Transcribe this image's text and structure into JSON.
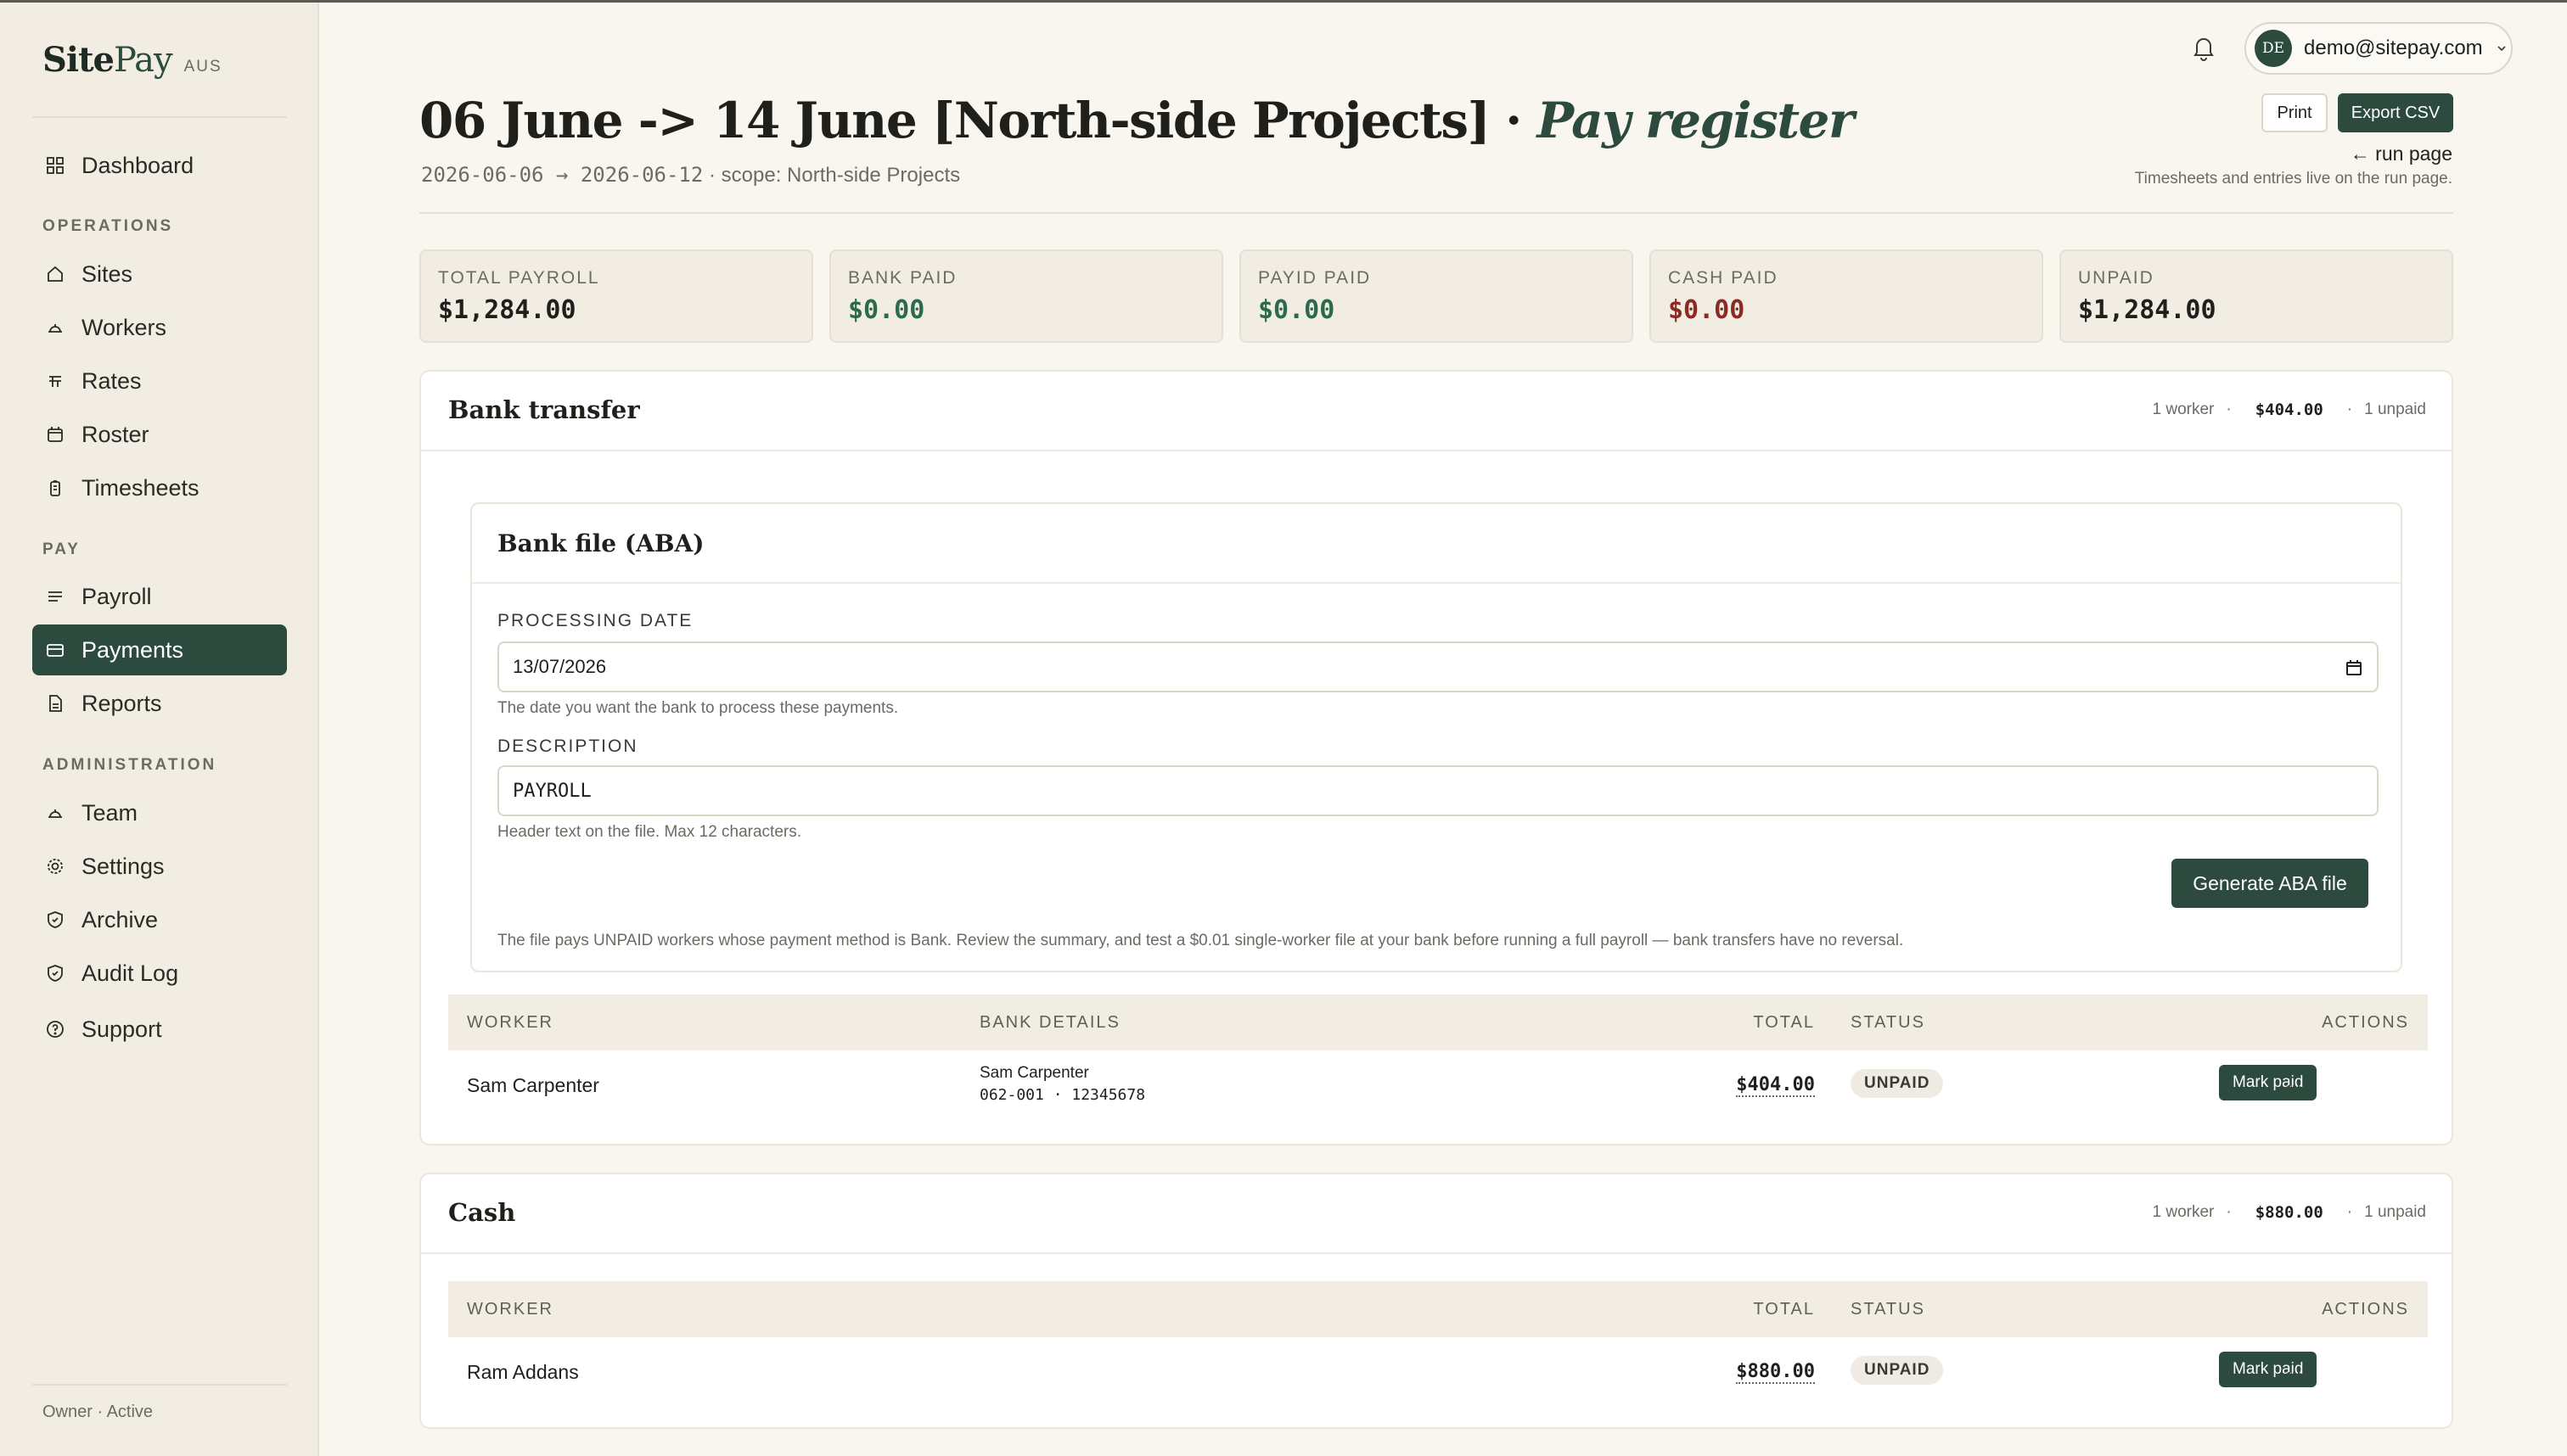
{
  "brand": {
    "name_a": "Site",
    "name_b": "Pay",
    "region": "AUS"
  },
  "sidebar": {
    "dashboard": "Dashboard",
    "sections": {
      "operations": "OPERATIONS",
      "pay": "PAY",
      "administration": "ADMINISTRATION"
    },
    "operations": [
      "Sites",
      "Workers",
      "Rates",
      "Roster",
      "Timesheets"
    ],
    "pay": [
      "Payroll",
      "Payments",
      "Reports"
    ],
    "administration": [
      "Team",
      "Settings",
      "Archive",
      "Audit Log",
      "Support"
    ],
    "active_item": "Payments",
    "footer": "Owner · Active"
  },
  "topbar": {
    "avatar_initials": "DE",
    "email": "demo@sitepay.com"
  },
  "header": {
    "title_main": "06 June -> 14 June [North-side Projects] · ",
    "title_accent": "Pay register",
    "sub_dates": "2026-06-06 → 2026-06-12",
    "sub_scope": " · scope: North-side Projects",
    "print_label": "Print",
    "export_label": "Export CSV",
    "run_link": "← run page",
    "run_note": "Timesheets and entries live on the run page."
  },
  "stats": [
    {
      "label": "TOTAL PAYROLL",
      "value": "$1,284.00",
      "color": "#1f1f1c"
    },
    {
      "label": "BANK PAID",
      "value": "$0.00",
      "color": "#2c6a4d"
    },
    {
      "label": "PAYID PAID",
      "value": "$0.00",
      "color": "#2c6a4d"
    },
    {
      "label": "CASH PAID",
      "value": "$0.00",
      "color": "#8b2a22"
    },
    {
      "label": "UNPAID",
      "value": "$1,284.00",
      "color": "#1f1f1c"
    }
  ],
  "bank": {
    "title": "Bank transfer",
    "meta_workers": "1 worker",
    "meta_amount": "$404.00",
    "meta_unpaid": "1 unpaid",
    "aba": {
      "title": "Bank file (ABA)",
      "date_label": "PROCESSING DATE",
      "date_value": "13/07/2026",
      "date_hint": "The date you want the bank to process these payments.",
      "desc_label": "DESCRIPTION",
      "desc_value": "PAYROLL",
      "desc_hint": "Header text on the file. Max 12 characters.",
      "generate_label": "Generate ABA file",
      "note": "The file pays UNPAID workers whose payment method is Bank. Review the summary, and test a $0.01 single-worker file at your bank before running a full payroll — bank transfers have no reversal."
    },
    "columns": {
      "worker": "WORKER",
      "bank_details": "BANK DETAILS",
      "total": "TOTAL",
      "status": "STATUS",
      "actions": "ACTIONS"
    },
    "rows": [
      {
        "worker": "Sam Carpenter",
        "bank_name": "Sam Carpenter",
        "bank_acct": "062-001 · 12345678",
        "total": "$404.00",
        "status": "UNPAID",
        "action": "Mark paid",
        "more": "..."
      }
    ]
  },
  "cash": {
    "title": "Cash",
    "meta_workers": "1 worker",
    "meta_amount": "$880.00",
    "meta_unpaid": "1 unpaid",
    "columns": {
      "worker": "WORKER",
      "total": "TOTAL",
      "status": "STATUS",
      "actions": "ACTIONS"
    },
    "rows": [
      {
        "worker": "Ram Addans",
        "total": "$880.00",
        "status": "UNPAID",
        "action": "Mark paid",
        "more": "..."
      }
    ]
  }
}
